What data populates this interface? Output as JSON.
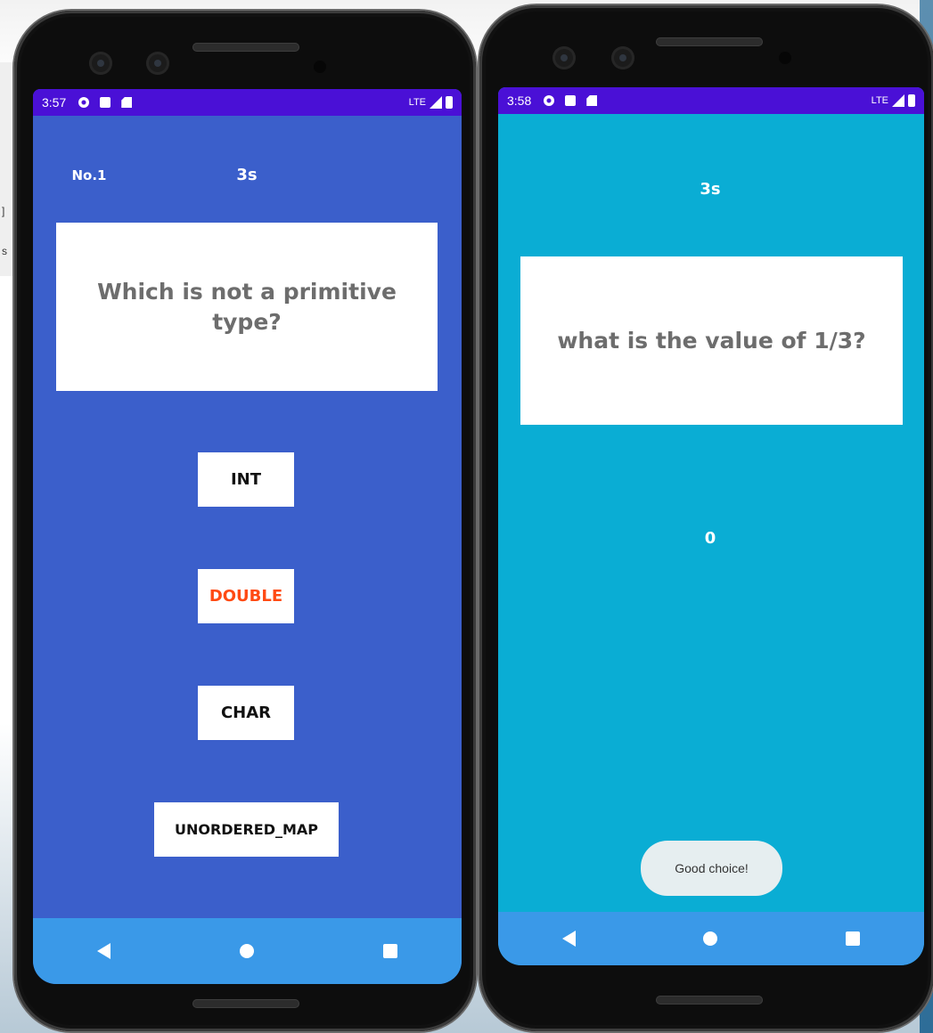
{
  "left_phone": {
    "status": {
      "time": "3:57",
      "network": "LTE"
    },
    "question_number": "No.1",
    "timer": "3s",
    "question": "Which is not a primitive type?",
    "options": [
      {
        "label": "INT",
        "color": "#111111"
      },
      {
        "label": "DOUBLE",
        "color": "#ff4a13"
      },
      {
        "label": "CHAR",
        "color": "#111111"
      },
      {
        "label": "UNORDERED_MAP",
        "color": "#111111"
      }
    ],
    "colors": {
      "background": "#3b5fcb",
      "status_bar": "#4a10d6",
      "nav_bar": "#3a99e8"
    }
  },
  "right_phone": {
    "status": {
      "time": "3:58",
      "network": "LTE"
    },
    "timer": "3s",
    "question": "what is the value of 1/3?",
    "answer": "0",
    "toast": "Good choice!",
    "colors": {
      "background": "#0aadd4",
      "status_bar": "#4a10d6",
      "nav_bar": "#3a99e8"
    }
  },
  "icons": [
    "settings-icon",
    "a-notification-icon",
    "sd-card-icon",
    "signal-icon",
    "battery-icon",
    "back-icon",
    "home-icon",
    "recents-icon"
  ]
}
